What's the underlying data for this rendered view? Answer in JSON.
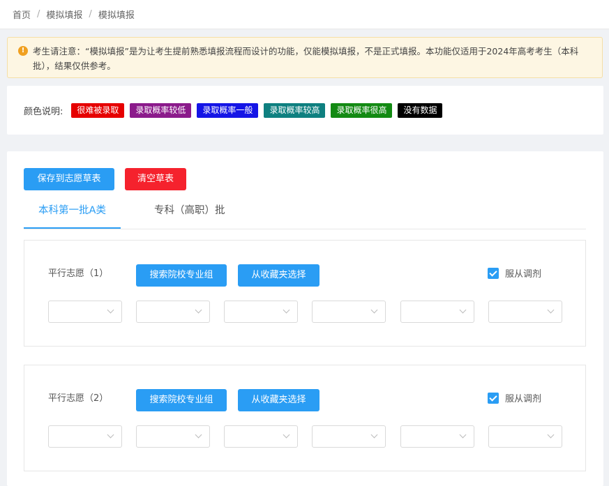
{
  "breadcrumb": {
    "items": [
      "首页",
      "模拟填报",
      "模拟填报"
    ],
    "separator": "/"
  },
  "notice": {
    "icon": "exclamation-icon",
    "text": "考生请注意：“模拟填报”是为让考生提前熟悉填报流程而设计的功能，仅能模拟填报，不是正式填报。本功能仅适用于2024年高考考生（本科批），结果仅供参考。"
  },
  "legend": {
    "label": "颜色说明:",
    "items": [
      {
        "label": "很难被录取",
        "color": "#e60000"
      },
      {
        "label": "录取概率较低",
        "color": "#8b1a8b"
      },
      {
        "label": "录取概率一般",
        "color": "#1515e6"
      },
      {
        "label": "录取概率较高",
        "color": "#0f8080"
      },
      {
        "label": "录取概率很高",
        "color": "#138a13"
      },
      {
        "label": "没有数据",
        "color": "#000000"
      }
    ]
  },
  "actions": {
    "save_label": "保存到志愿草表",
    "clear_label": "清空草表"
  },
  "tabs": [
    {
      "label": "本科第一批A类",
      "active": true
    },
    {
      "label": "专科（高职）批",
      "active": false
    }
  ],
  "groups": [
    {
      "label": "平行志愿（1）",
      "search_label": "搜索院校专业组",
      "favorites_label": "从收藏夹选择",
      "obey_label": "服从调剂",
      "obey_checked": true
    },
    {
      "label": "平行志愿（2）",
      "search_label": "搜索院校专业组",
      "favorites_label": "从收藏夹选择",
      "obey_label": "服从调剂",
      "obey_checked": true
    }
  ],
  "colors": {
    "primary": "#2a9df4",
    "danger": "#f5222d"
  }
}
